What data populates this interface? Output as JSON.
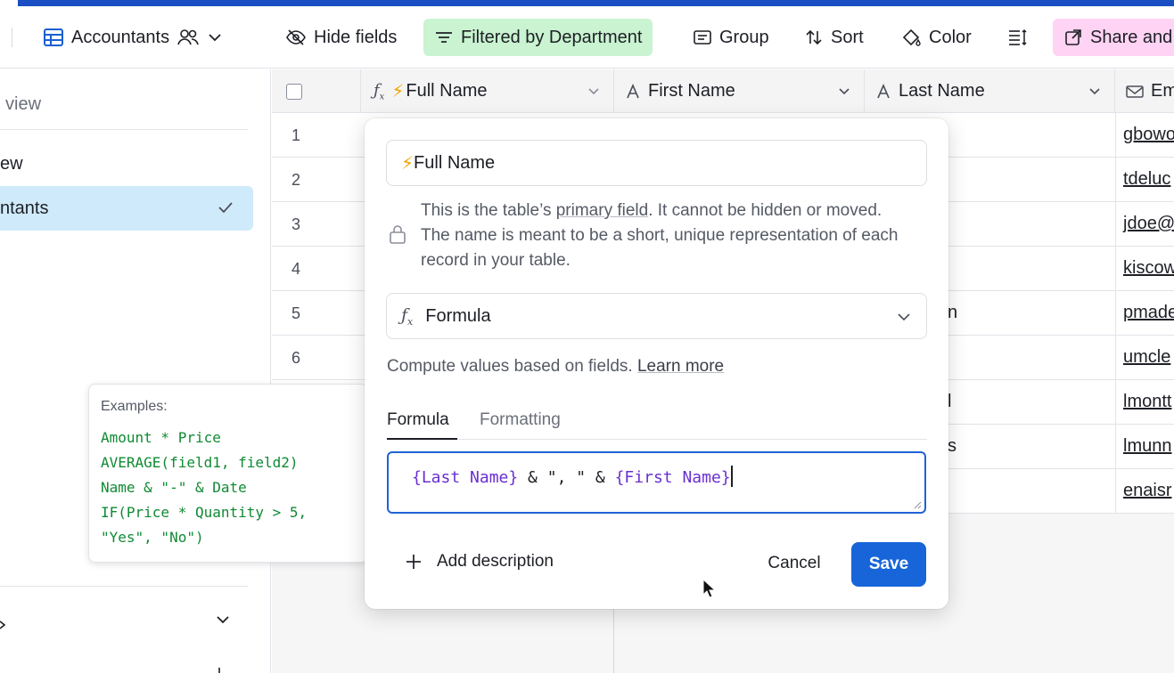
{
  "toolbar": {
    "view_name": "Accountants",
    "hide_fields": "Hide fields",
    "filter": "Filtered by Department",
    "group": "Group",
    "sort": "Sort",
    "color": "Color",
    "share": "Share and"
  },
  "sidebar": {
    "find_view": "view",
    "items": [
      {
        "label": "ew"
      },
      {
        "label": "ntants",
        "active": true
      }
    ]
  },
  "grid": {
    "columns": [
      {
        "label": "Full Name",
        "type": "formula"
      },
      {
        "label": "First Name",
        "type": "text"
      },
      {
        "label": "Last Name",
        "type": "text"
      },
      {
        "label": "Em",
        "type": "email"
      }
    ],
    "rows": [
      {
        "num": "1",
        "frag": "",
        "email": "gbowo"
      },
      {
        "num": "2",
        "frag": "",
        "email": "tdeluc"
      },
      {
        "num": "3",
        "frag": "",
        "email": "jdoe@"
      },
      {
        "num": "4",
        "frag": "",
        "email": "kiscow"
      },
      {
        "num": "5",
        "frag": "n",
        "email": "pmade"
      },
      {
        "num": "6",
        "frag": "",
        "email": "umcle"
      },
      {
        "num": "",
        "frag": "l",
        "email": "lmontt"
      },
      {
        "num": "",
        "frag": "s",
        "email": "lmunn"
      },
      {
        "num": "",
        "frag": "",
        "email": "enaisr"
      }
    ]
  },
  "examples": {
    "title": "Examples:",
    "lines": [
      "Amount * Price",
      "AVERAGE(field1, field2)",
      "Name & \"-\" & Date",
      "IF(Price * Quantity > 5,",
      "\"Yes\", \"No\")"
    ]
  },
  "dialog": {
    "field_name": "Full Name",
    "field_name_icon": "⚡",
    "primary_note_pre": "This is the table’s ",
    "primary_note_link": "primary field",
    "primary_note_post": ". It cannot be hidden or moved. The name is meant to be a short, unique representation of each record in your table.",
    "field_type": "Formula",
    "compute_note": "Compute values based on fields.",
    "learn_more": "Learn more",
    "tabs": [
      "Formula",
      "Formatting"
    ],
    "formula_tokens": {
      "t1": "{Last Name}",
      "t2": " & \", \" & ",
      "t3": "{First Name}"
    },
    "add_description": "Add description",
    "cancel": "Cancel",
    "save": "Save"
  },
  "colors": {
    "accent": "#1765d9",
    "filter_bg": "#c9f3d1",
    "share_bg": "#ffd3f3",
    "active_view_bg": "#cfeafb",
    "formula_field_token": "#6a2fd0",
    "example_code": "#0f8a33"
  }
}
